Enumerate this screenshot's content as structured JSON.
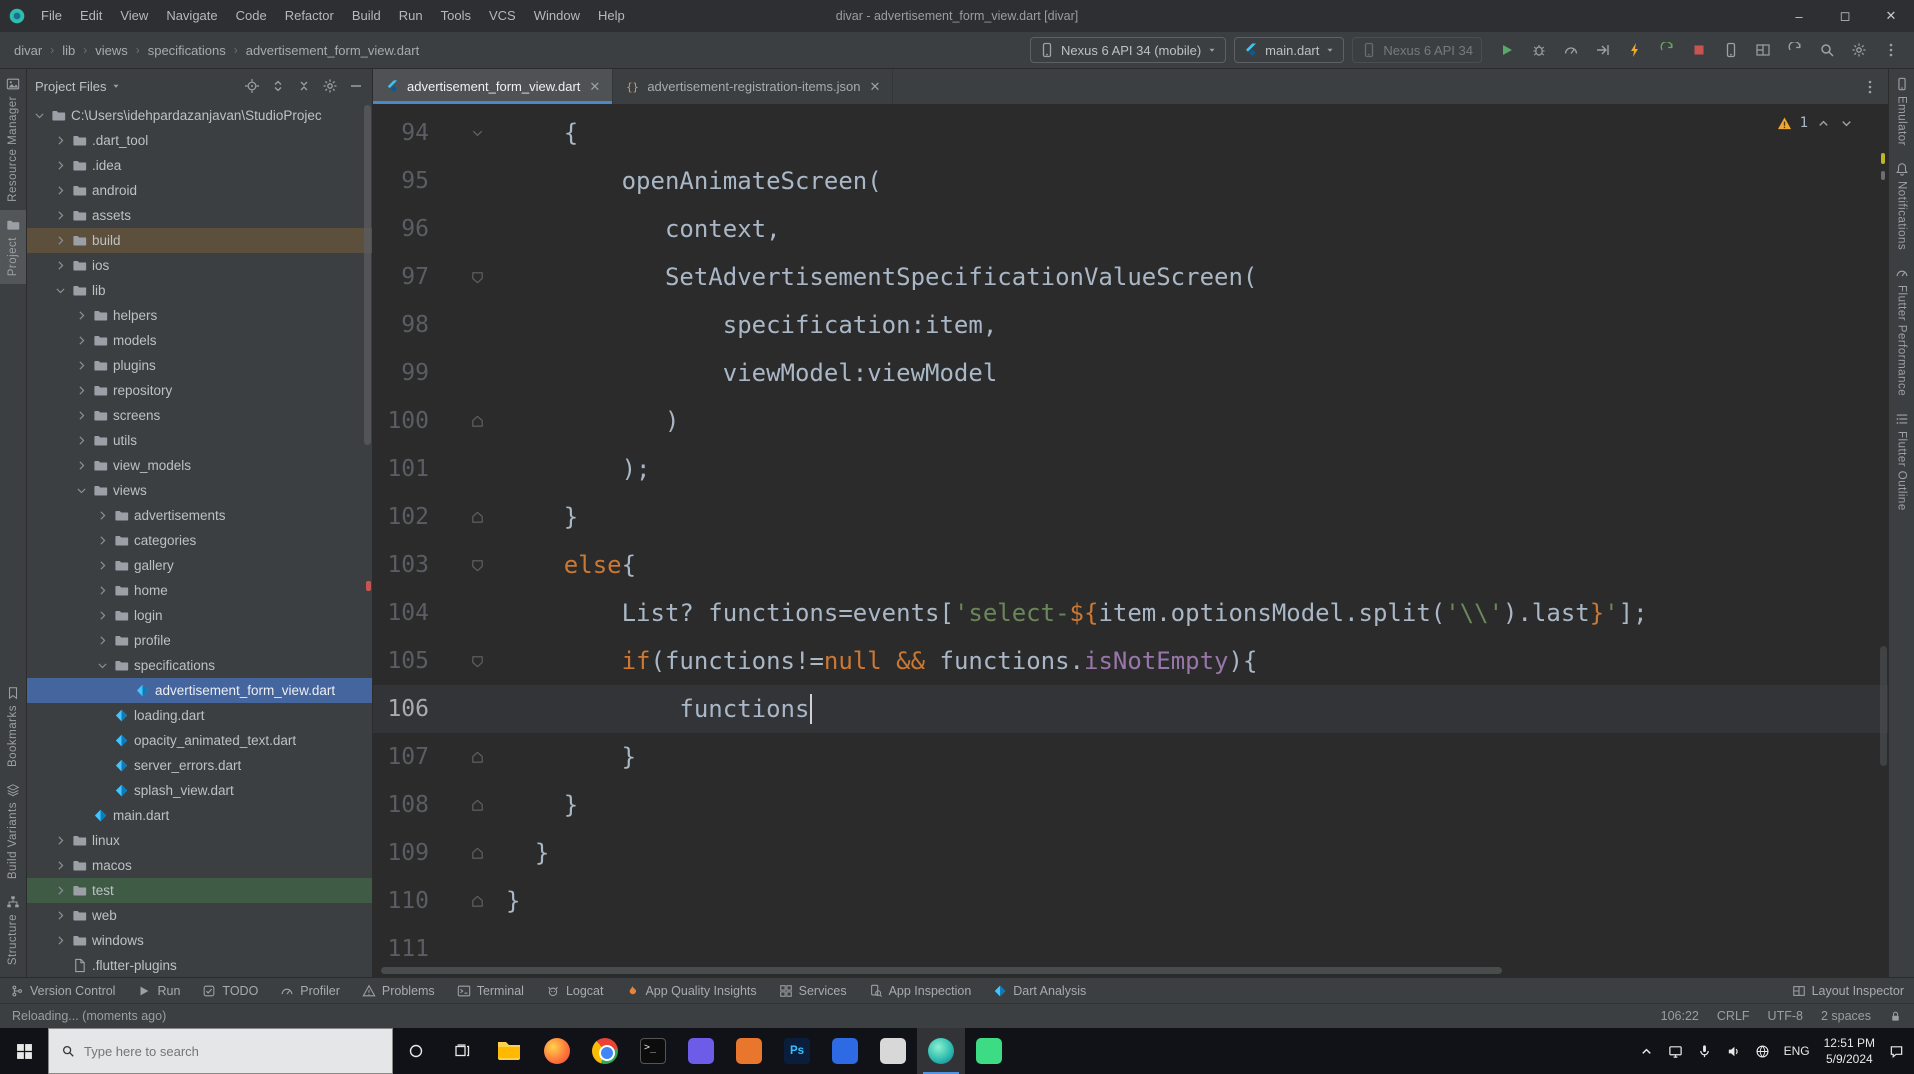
{
  "colors": {
    "selection_blue": "#44659e",
    "keyword_orange": "#cc7832",
    "string_green": "#6a8759",
    "property_purple": "#9876aa",
    "run_green": "#59a869",
    "stop_red": "#c75450",
    "hot_reload_yellow": "#f0a732",
    "warning_yellow": "#bbb529"
  },
  "window": {
    "title": "divar - advertisement_form_view.dart [divar]"
  },
  "titlebar": {
    "menus": [
      "File",
      "Edit",
      "View",
      "Navigate",
      "Code",
      "Refactor",
      "Build",
      "Run",
      "Tools",
      "VCS",
      "Window",
      "Help"
    ]
  },
  "breadcrumbs": [
    "divar",
    "lib",
    "views",
    "specifications",
    "advertisement_form_view.dart"
  ],
  "toolbar": {
    "device_selector": "Nexus 6 API 34 (mobile)",
    "run_config": "main.dart",
    "secondary_target": "Nexus 6 API 34",
    "actions": [
      {
        "name": "run-button",
        "icon": "play",
        "color": "#59a869"
      },
      {
        "name": "debug-button",
        "icon": "bug",
        "color": "#9da0a6"
      },
      {
        "name": "profiler-button",
        "icon": "gauge",
        "color": "#9da0a6"
      },
      {
        "name": "attach-debugger-button",
        "icon": "attach",
        "color": "#9da0a6"
      },
      {
        "name": "hot-reload-button",
        "icon": "bolt",
        "color": "#f0a732"
      },
      {
        "name": "hot-restart-button",
        "icon": "restart",
        "color": "#6ba65d"
      },
      {
        "name": "stop-button",
        "icon": "stop",
        "color": "#c75450"
      },
      {
        "name": "device-manager-button",
        "icon": "phone",
        "color": "#9da0a6"
      },
      {
        "name": "layout-inspector-button",
        "icon": "layout",
        "color": "#9da0a6"
      },
      {
        "name": "sync-project-button",
        "icon": "restart",
        "color": "#9da0a6"
      },
      {
        "name": "search-everywhere-button",
        "icon": "search",
        "color": "#9da0a6"
      },
      {
        "name": "settings-button",
        "icon": "gear",
        "color": "#9da0a6"
      },
      {
        "name": "more-actions-button",
        "icon": "more",
        "color": "#9da0a6"
      }
    ]
  },
  "left_stripe": {
    "top": [
      {
        "label": "Resource Manager",
        "icon": "resource",
        "active": false
      },
      {
        "label": "Project",
        "icon": "folder",
        "active": true
      }
    ],
    "bottom": [
      {
        "label": "Bookmarks",
        "icon": "bookmark",
        "active": false
      },
      {
        "label": "Build Variants",
        "icon": "layers",
        "active": false
      },
      {
        "label": "Structure",
        "icon": "structure",
        "active": false
      }
    ]
  },
  "right_stripe": {
    "items": [
      {
        "label": "Emulator",
        "icon": "phone"
      },
      {
        "label": "Notifications",
        "icon": "bell"
      },
      {
        "label": "Flutter Performance",
        "icon": "gauge"
      },
      {
        "label": "Flutter Outline",
        "icon": "outline"
      }
    ]
  },
  "project_panel": {
    "header": "Project Files",
    "header_icons": [
      "locate-icon",
      "expand-all-icon",
      "collapse-all-icon",
      "settings-icon",
      "hide-panel-icon"
    ],
    "tree": [
      {
        "label": "C:\\Users\\idehpardazanjavan\\StudioProjec",
        "level": 0,
        "kind": "folder",
        "state": "open"
      },
      {
        "label": ".dart_tool",
        "level": 1,
        "kind": "folder",
        "state": "closed"
      },
      {
        "label": ".idea",
        "level": 1,
        "kind": "folder",
        "state": "closed"
      },
      {
        "label": "android",
        "level": 1,
        "kind": "folder",
        "state": "closed"
      },
      {
        "label": "assets",
        "level": 1,
        "kind": "folder",
        "state": "closed"
      },
      {
        "label": "build",
        "level": 1,
        "kind": "folder",
        "state": "closed",
        "bg": "excluded"
      },
      {
        "label": "ios",
        "level": 1,
        "kind": "folder",
        "state": "closed"
      },
      {
        "label": "lib",
        "level": 1,
        "kind": "folder",
        "state": "open"
      },
      {
        "label": "helpers",
        "level": 2,
        "kind": "folder",
        "state": "closed"
      },
      {
        "label": "models",
        "level": 2,
        "kind": "folder",
        "state": "closed"
      },
      {
        "label": "plugins",
        "level": 2,
        "kind": "folder",
        "state": "closed"
      },
      {
        "label": "repository",
        "level": 2,
        "kind": "folder",
        "state": "closed"
      },
      {
        "label": "screens",
        "level": 2,
        "kind": "folder",
        "state": "closed"
      },
      {
        "label": "utils",
        "level": 2,
        "kind": "folder",
        "state": "closed"
      },
      {
        "label": "view_models",
        "level": 2,
        "kind": "folder",
        "state": "closed"
      },
      {
        "label": "views",
        "level": 2,
        "kind": "folder",
        "state": "open"
      },
      {
        "label": "advertisements",
        "level": 3,
        "kind": "folder",
        "state": "closed"
      },
      {
        "label": "categories",
        "level": 3,
        "kind": "folder",
        "state": "closed"
      },
      {
        "label": "gallery",
        "level": 3,
        "kind": "folder",
        "state": "closed"
      },
      {
        "label": "home",
        "level": 3,
        "kind": "folder",
        "state": "closed"
      },
      {
        "label": "login",
        "level": 3,
        "kind": "folder",
        "state": "closed"
      },
      {
        "label": "profile",
        "level": 3,
        "kind": "folder",
        "state": "closed"
      },
      {
        "label": "specifications",
        "level": 3,
        "kind": "folder",
        "state": "open"
      },
      {
        "label": "advertisement_form_view.dart",
        "level": 4,
        "kind": "dart",
        "state": "none",
        "selected": true
      },
      {
        "label": "loading.dart",
        "level": 3,
        "kind": "dart",
        "state": "none"
      },
      {
        "label": "opacity_animated_text.dart",
        "level": 3,
        "kind": "dart",
        "state": "none"
      },
      {
        "label": "server_errors.dart",
        "level": 3,
        "kind": "dart",
        "state": "none"
      },
      {
        "label": "splash_view.dart",
        "level": 3,
        "kind": "dart",
        "state": "none"
      },
      {
        "label": "main.dart",
        "level": 2,
        "kind": "dart",
        "state": "none"
      },
      {
        "label": "linux",
        "level": 1,
        "kind": "folder",
        "state": "closed"
      },
      {
        "label": "macos",
        "level": 1,
        "kind": "folder",
        "state": "closed"
      },
      {
        "label": "test",
        "level": 1,
        "kind": "folder",
        "state": "closed",
        "bg": "test"
      },
      {
        "label": "web",
        "level": 1,
        "kind": "folder",
        "state": "closed"
      },
      {
        "label": "windows",
        "level": 1,
        "kind": "folder",
        "state": "closed"
      },
      {
        "label": ".flutter-plugins",
        "level": 1,
        "kind": "file",
        "state": "none"
      }
    ]
  },
  "editor": {
    "tabs": [
      {
        "label": "advertisement_form_view.dart",
        "icon": "flutter",
        "active": true
      },
      {
        "label": "advertisement-registration-items.json",
        "icon": "json",
        "active": false
      }
    ],
    "inspection": {
      "warnings": "1"
    },
    "code": {
      "lines": [
        {
          "n": 94,
          "m": "chev",
          "seg": [
            [
              "    {",
              "d"
            ]
          ]
        },
        {
          "n": 95,
          "seg": [
            [
              "        openAnimateScreen(",
              "d"
            ]
          ]
        },
        {
          "n": 96,
          "seg": [
            [
              "           context,",
              "d"
            ]
          ]
        },
        {
          "n": 97,
          "m": "fdown",
          "seg": [
            [
              "           SetAdvertisementSpecificationValueScreen(",
              "d"
            ]
          ]
        },
        {
          "n": 98,
          "seg": [
            [
              "               specification:item,",
              "d"
            ]
          ]
        },
        {
          "n": 99,
          "seg": [
            [
              "               viewModel:viewModel",
              "d"
            ]
          ]
        },
        {
          "n": 100,
          "m": "fup",
          "seg": [
            [
              "           )",
              "d"
            ]
          ]
        },
        {
          "n": 101,
          "seg": [
            [
              "        );",
              "d"
            ]
          ]
        },
        {
          "n": 102,
          "m": "fup",
          "seg": [
            [
              "    }",
              "d"
            ]
          ]
        },
        {
          "n": 103,
          "m": "fdown",
          "seg": [
            [
              "    ",
              "d"
            ],
            [
              "else",
              "k"
            ],
            [
              "{",
              "d"
            ]
          ]
        },
        {
          "n": 104,
          "seg": [
            [
              "        List? functions=events[",
              "d"
            ],
            [
              "'select-",
              "s"
            ],
            [
              "${",
              "k"
            ],
            [
              "item.optionsModel.split(",
              "d"
            ],
            [
              "'\\\\'",
              "s"
            ],
            [
              ").last",
              "d"
            ],
            [
              "}",
              "k"
            ],
            [
              "'",
              "s"
            ],
            [
              "];",
              "d"
            ]
          ]
        },
        {
          "n": 105,
          "m": "fdown",
          "seg": [
            [
              "        ",
              "d"
            ],
            [
              "if",
              "k"
            ],
            [
              "(functions!=",
              "d"
            ],
            [
              "null",
              "k"
            ],
            [
              " ",
              "d"
            ],
            [
              "&&",
              "k"
            ],
            [
              " functions.",
              "d"
            ],
            [
              "isNotEmpty",
              "p"
            ],
            [
              "){",
              "d"
            ]
          ]
        },
        {
          "n": 106,
          "hl": true,
          "cursor": true,
          "seg": [
            [
              "            functions",
              "d"
            ]
          ]
        },
        {
          "n": 107,
          "m": "fup",
          "seg": [
            [
              "        }",
              "d"
            ]
          ]
        },
        {
          "n": 108,
          "m": "fup",
          "seg": [
            [
              "    }",
              "d"
            ]
          ]
        },
        {
          "n": 109,
          "m": "fup",
          "seg": [
            [
              "  }",
              "d"
            ]
          ]
        },
        {
          "n": 110,
          "m": "fup",
          "seg": [
            [
              "}",
              "d"
            ]
          ]
        },
        {
          "n": 111,
          "seg": []
        }
      ]
    }
  },
  "tool_windows": {
    "items": [
      {
        "label": "Version Control",
        "icon": "branch"
      },
      {
        "label": "Run",
        "icon": "play"
      },
      {
        "label": "TODO",
        "icon": "todo"
      },
      {
        "label": "Profiler",
        "icon": "gauge"
      },
      {
        "label": "Problems",
        "icon": "warntri"
      },
      {
        "label": "Terminal",
        "icon": "terminal"
      },
      {
        "label": "Logcat",
        "icon": "logcat"
      },
      {
        "label": "App Quality Insights",
        "icon": "flame"
      },
      {
        "label": "Services",
        "icon": "services"
      },
      {
        "label": "App Inspection",
        "icon": "inspect"
      },
      {
        "label": "Dart Analysis",
        "icon": "dart"
      }
    ],
    "right": "Layout Inspector"
  },
  "status_bar": {
    "message": "Reloading... (moments ago)",
    "cursor_position": "106:22",
    "line_ending": "CRLF",
    "encoding": "UTF-8",
    "indent": "2 spaces"
  },
  "taskbar": {
    "search_placeholder": "Type here to search",
    "language": "ENG",
    "time": "12:51 PM",
    "date": "5/9/2024",
    "apps": [
      {
        "name": "file-explorer-icon",
        "kind": "explorer"
      },
      {
        "name": "firefox-icon",
        "kind": "ff"
      },
      {
        "name": "chrome-icon",
        "kind": "chrome"
      },
      {
        "name": "command-prompt-icon",
        "kind": "cmd"
      },
      {
        "name": "app-icon-purple",
        "kind": "sq",
        "color": "#6c5ce7"
      },
      {
        "name": "app-icon-orange",
        "kind": "sq",
        "color": "#e8762c"
      },
      {
        "name": "photoshop-icon",
        "kind": "ps"
      },
      {
        "name": "app-icon-blue",
        "kind": "sq",
        "color": "#2d6ae3"
      },
      {
        "name": "app-icon-gray",
        "kind": "sq",
        "color": "#d8d8d8"
      },
      {
        "name": "android-studio-icon",
        "kind": "as",
        "active": true
      },
      {
        "name": "app-icon-green",
        "kind": "sq",
        "color": "#3ddc84"
      }
    ]
  }
}
